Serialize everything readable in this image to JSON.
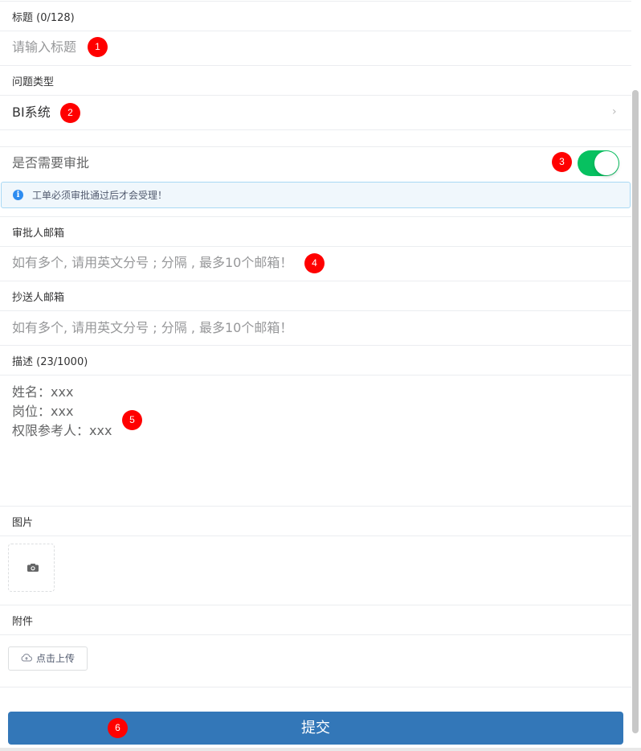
{
  "form": {
    "title": {
      "label": "标题 (0/128)",
      "placeholder": "请输入标题",
      "badge": "1"
    },
    "issue_type": {
      "label": "问题类型",
      "value": "BI系统",
      "chevron": "›",
      "badge": "2"
    },
    "approval": {
      "label": "是否需要审批",
      "enabled": true,
      "badge": "3",
      "notice_icon": "i",
      "notice": "工单必须审批通过后才会受理！"
    },
    "approver_email": {
      "label": "审批人邮箱",
      "placeholder": "如有多个, 请用英文分号 ; 分隔 , 最多10个邮箱！",
      "badge": "4"
    },
    "cc_email": {
      "label": "抄送人邮箱",
      "placeholder": "如有多个, 请用英文分号 ; 分隔 , 最多10个邮箱！"
    },
    "description": {
      "label": "描述 (23/1000)",
      "lines": [
        "姓名：xxx",
        "岗位：xxx",
        "权限参考人：xxx"
      ],
      "badge": "5"
    },
    "image": {
      "label": "图片",
      "icon": "camera-icon"
    },
    "attachment": {
      "label": "附件",
      "upload_label": "点击上传",
      "icon": "cloud-upload-icon"
    },
    "submit": {
      "label": "提交",
      "badge": "6"
    }
  },
  "colors": {
    "toggle_on": "#07c160",
    "submit_bg": "#3377b8",
    "badge": "#ff0000",
    "notice_bg": "#f0f7fc",
    "notice_border": "#a9d9f4",
    "info_icon": "#2d8cf0"
  }
}
